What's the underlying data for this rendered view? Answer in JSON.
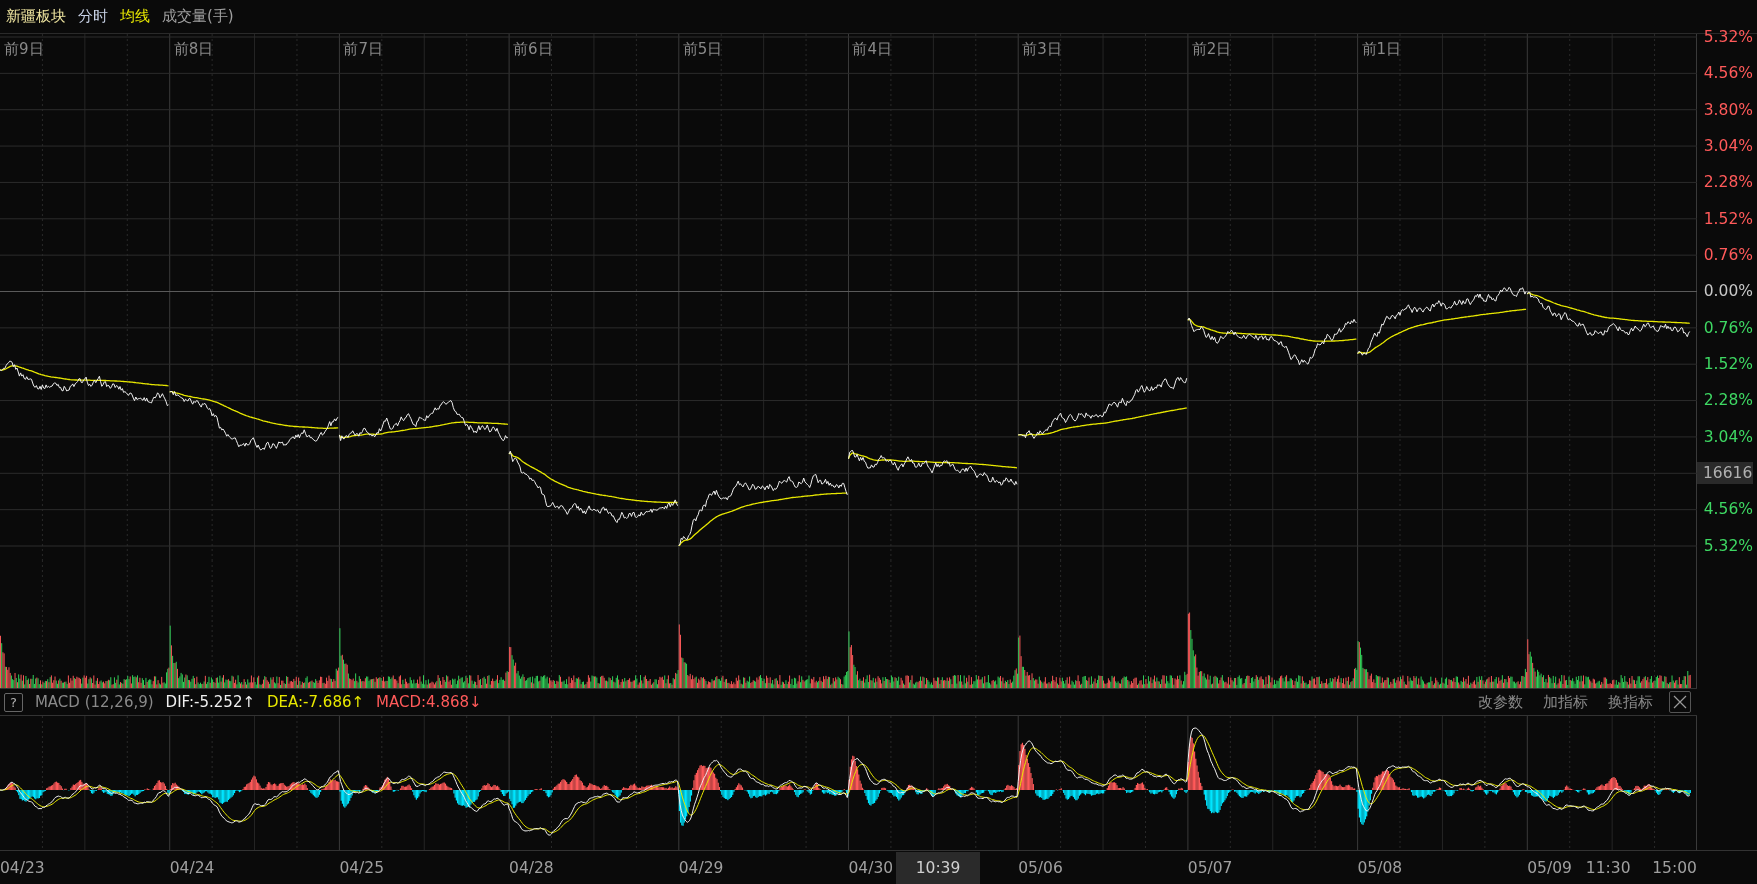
{
  "legend": [
    {
      "label": "新疆板块",
      "color": "#f0e6a0"
    },
    {
      "label": "分时",
      "color": "#c8d2e6"
    },
    {
      "label": "均线",
      "color": "#e8e800"
    },
    {
      "label": "成交量(手)",
      "color": "#a0a0a0"
    }
  ],
  "day_labels": [
    "前9日",
    "前8日",
    "前7日",
    "前6日",
    "前5日",
    "前4日",
    "前3日",
    "前2日",
    "前1日"
  ],
  "y_axis": [
    {
      "label": "5.32%",
      "kind": "up"
    },
    {
      "label": "4.56%",
      "kind": "up"
    },
    {
      "label": "3.80%",
      "kind": "up"
    },
    {
      "label": "3.04%",
      "kind": "up"
    },
    {
      "label": "2.28%",
      "kind": "up"
    },
    {
      "label": "1.52%",
      "kind": "up"
    },
    {
      "label": "0.76%",
      "kind": "up"
    },
    {
      "label": "0.00%",
      "kind": "flat"
    },
    {
      "label": "0.76%",
      "kind": "down"
    },
    {
      "label": "1.52%",
      "kind": "down"
    },
    {
      "label": "2.28%",
      "kind": "down"
    },
    {
      "label": "3.04%",
      "kind": "down"
    },
    {
      "label": "16616",
      "kind": "cursor"
    },
    {
      "label": "4.56%",
      "kind": "down"
    },
    {
      "label": "5.32%",
      "kind": "down"
    }
  ],
  "macd_bar": {
    "help": "?",
    "name": "MACD (12,26,9)",
    "values": [
      {
        "label": "DIF:-5.252↑",
        "color": "#f0f0f0"
      },
      {
        "label": "DEA:-7.686↑",
        "color": "#e8e800"
      },
      {
        "label": "MACD:4.868↓",
        "color": "#ff5a5a"
      }
    ],
    "actions": [
      "改参数",
      "加指标",
      "换指标"
    ]
  },
  "x_axis": {
    "dates": [
      "04/23",
      "04/24",
      "04/25",
      "04/28",
      "04/29",
      "04/30",
      "05/06",
      "05/07",
      "05/08",
      "05/09"
    ],
    "cursor_time": "10:39",
    "midday": "11:30",
    "close": "15:00"
  }
}
